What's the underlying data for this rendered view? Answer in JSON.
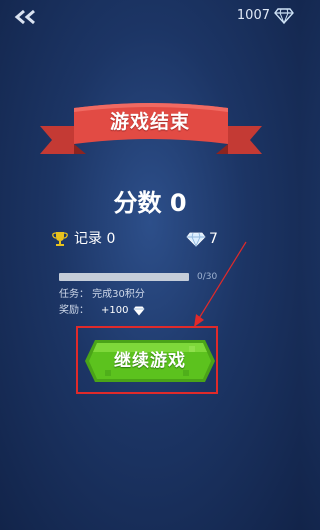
{
  "header": {
    "back_icon": "double-chevron-left-icon",
    "gem_count": "1007",
    "gem_icon": "diamond-icon"
  },
  "banner": {
    "title": "游戏结束",
    "color": "#e24b44"
  },
  "score": {
    "text": "分数 0"
  },
  "stats": {
    "record_icon": "trophy-icon",
    "record_text": "记录 0",
    "gem_icon": "diamond-icon",
    "gem_value": "7"
  },
  "task": {
    "progress_text": "0/30",
    "progress_fraction": 0,
    "description": "任务：  完成30积分",
    "reward_label": "奖励：",
    "reward_value": "+100",
    "reward_icon": "diamond-icon"
  },
  "continue_button": {
    "label": "继续游戏",
    "color": "#5cc21e"
  },
  "annotation": {
    "color": "#e02a2a"
  }
}
